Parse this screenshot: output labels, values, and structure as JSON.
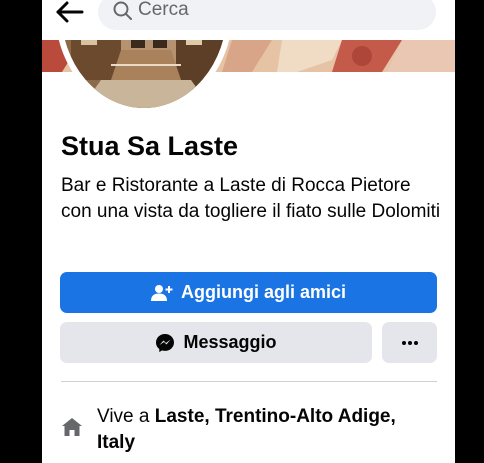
{
  "topbar": {
    "back_icon": "arrow-left-icon",
    "search_icon": "search-icon",
    "search_placeholder": "Cerca"
  },
  "profile": {
    "name": "Stua Sa Laste",
    "description": "Bar e Ristorante a Laste di Rocca Pietore con una vista da togliere il fiato sulle Dolomiti"
  },
  "actions": {
    "add_friend_label": "Aggiungi agli amici",
    "add_friend_icon": "add-friend-icon",
    "message_label": "Messaggio",
    "message_icon": "messenger-icon",
    "more_icon": "more-dots-icon"
  },
  "intro": {
    "lives_prefix": "Vive a ",
    "lives_location": "Laste, Trentino-Alto Adige, Italy",
    "lives_icon": "home-icon"
  },
  "colors": {
    "primary": "#1b74e4",
    "secondary_bg": "#e4e6eb",
    "text": "#050505",
    "muted": "#65676b"
  }
}
